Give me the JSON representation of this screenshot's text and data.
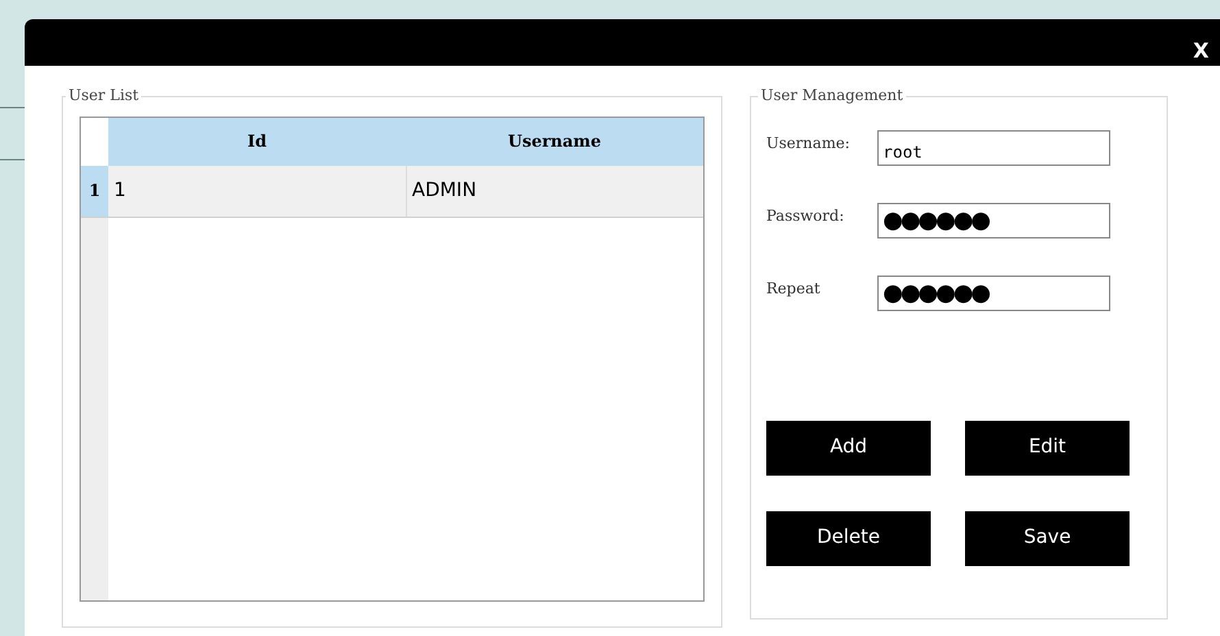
{
  "window": {
    "close": "X"
  },
  "user_list": {
    "title": "User List",
    "columns": [
      "Id",
      "Username"
    ],
    "rows": [
      {
        "header": "1",
        "cells": [
          "1",
          "ADMIN"
        ],
        "selected": true
      }
    ]
  },
  "user_management": {
    "title": "User Management",
    "fields": [
      {
        "label": "Username:",
        "value": "root"
      },
      {
        "label": "Password:",
        "value": "●●●●●●"
      },
      {
        "label": "Repeat",
        "value": "●●●●●●"
      }
    ],
    "buttons": [
      "Add",
      "Edit",
      "Delete",
      "Save"
    ]
  }
}
